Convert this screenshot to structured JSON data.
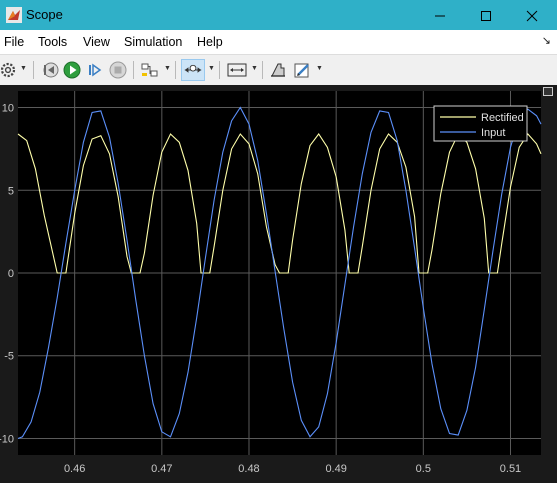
{
  "window": {
    "title": "Scope",
    "controls": [
      "minimize-icon",
      "maximize-icon",
      "close-icon"
    ]
  },
  "menu": {
    "items": [
      "File",
      "Tools",
      "View",
      "Simulation",
      "Help"
    ]
  },
  "toolbar": {
    "icons": [
      "gear-icon",
      "step-back-icon",
      "run-icon",
      "step-forward-icon",
      "stop-icon",
      "highlight-icon",
      "zoom-icon",
      "scale-axes-icon",
      "measure-icon",
      "edit-icon"
    ]
  },
  "colors": {
    "rectified": "#ffffaa",
    "input": "#5b8ff9",
    "plot_bg": "#000000",
    "grid": "#5a5a5a"
  },
  "chart_data": {
    "type": "line",
    "xlim": [
      0.4535,
      0.5135
    ],
    "ylim": [
      -11,
      11
    ],
    "x_ticks": [
      0.46,
      0.47,
      0.48,
      0.49,
      0.5,
      0.51
    ],
    "x_tick_labels": [
      "0.46",
      "0.47",
      "0.48",
      "0.49",
      "0.5",
      "0.51"
    ],
    "y_ticks": [
      -10,
      -5,
      0,
      5,
      10
    ],
    "y_tick_labels": [
      "-10",
      "-5",
      "0",
      "5",
      "10"
    ],
    "grid": true,
    "legend": "top-right",
    "series": [
      {
        "name": "Rectified",
        "x": [
          0.4535,
          0.4545,
          0.4555,
          0.4565,
          0.458,
          0.4585,
          0.459,
          0.46,
          0.461,
          0.462,
          0.463,
          0.464,
          0.465,
          0.466,
          0.4665,
          0.4675,
          0.468,
          0.469,
          0.47,
          0.471,
          0.472,
          0.473,
          0.474,
          0.4745,
          0.4755,
          0.476,
          0.477,
          0.478,
          0.479,
          0.48,
          0.481,
          0.482,
          0.483,
          0.4835,
          0.4845,
          0.485,
          0.486,
          0.487,
          0.488,
          0.489,
          0.49,
          0.491,
          0.4915,
          0.4925,
          0.493,
          0.494,
          0.495,
          0.496,
          0.497,
          0.498,
          0.499,
          0.4995,
          0.5005,
          0.501,
          0.502,
          0.503,
          0.504,
          0.505,
          0.506,
          0.507,
          0.5075,
          0.5085,
          0.509,
          0.51,
          0.511,
          0.512,
          0.513,
          0.5135
        ],
        "values": [
          8.4,
          8.0,
          6.3,
          3.5,
          0,
          0,
          0,
          3.6,
          6.5,
          8.1,
          8.3,
          7.2,
          4.6,
          1.0,
          0,
          0,
          1.2,
          4.7,
          7.3,
          8.4,
          7.9,
          6.2,
          3.0,
          0,
          0,
          1.6,
          5.0,
          7.5,
          8.4,
          7.8,
          6.0,
          2.8,
          0.5,
          0,
          0,
          2.0,
          5.4,
          7.7,
          8.4,
          7.6,
          5.8,
          2.6,
          0,
          0,
          1.6,
          5.0,
          7.5,
          8.4,
          7.9,
          6.4,
          3.4,
          0,
          0,
          1.4,
          4.8,
          7.3,
          8.4,
          7.9,
          6.3,
          3.3,
          0,
          0,
          1.8,
          5.2,
          7.6,
          8.4,
          7.8,
          7.2
        ]
      },
      {
        "name": "Input",
        "x": [
          0.4535,
          0.454,
          0.455,
          0.456,
          0.457,
          0.458,
          0.459,
          0.46,
          0.461,
          0.462,
          0.463,
          0.464,
          0.465,
          0.466,
          0.467,
          0.468,
          0.469,
          0.47,
          0.471,
          0.472,
          0.473,
          0.474,
          0.475,
          0.476,
          0.477,
          0.478,
          0.479,
          0.48,
          0.481,
          0.482,
          0.483,
          0.484,
          0.485,
          0.486,
          0.487,
          0.488,
          0.489,
          0.49,
          0.491,
          0.492,
          0.493,
          0.494,
          0.495,
          0.496,
          0.497,
          0.498,
          0.499,
          0.5,
          0.501,
          0.502,
          0.503,
          0.504,
          0.505,
          0.506,
          0.507,
          0.508,
          0.509,
          0.51,
          0.511,
          0.512,
          0.513,
          0.5135
        ],
        "values": [
          -10,
          -9.9,
          -9.0,
          -7.2,
          -4.5,
          -1.5,
          1.8,
          5.0,
          7.9,
          9.7,
          9.8,
          8.2,
          5.4,
          2.0,
          -1.6,
          -5.0,
          -7.9,
          -9.6,
          -9.9,
          -8.5,
          -6.0,
          -2.7,
          0.9,
          4.4,
          7.3,
          9.2,
          10,
          9.0,
          6.8,
          3.6,
          0.1,
          -3.4,
          -6.6,
          -8.9,
          -9.9,
          -9.3,
          -7.3,
          -4.2,
          -0.7,
          2.8,
          6.0,
          8.5,
          9.8,
          9.7,
          8.0,
          5.0,
          1.5,
          -2.1,
          -5.5,
          -8.2,
          -9.7,
          -9.8,
          -8.3,
          -5.7,
          -2.2,
          1.4,
          4.8,
          7.6,
          9.4,
          9.9,
          9.5,
          9.0
        ]
      }
    ]
  }
}
